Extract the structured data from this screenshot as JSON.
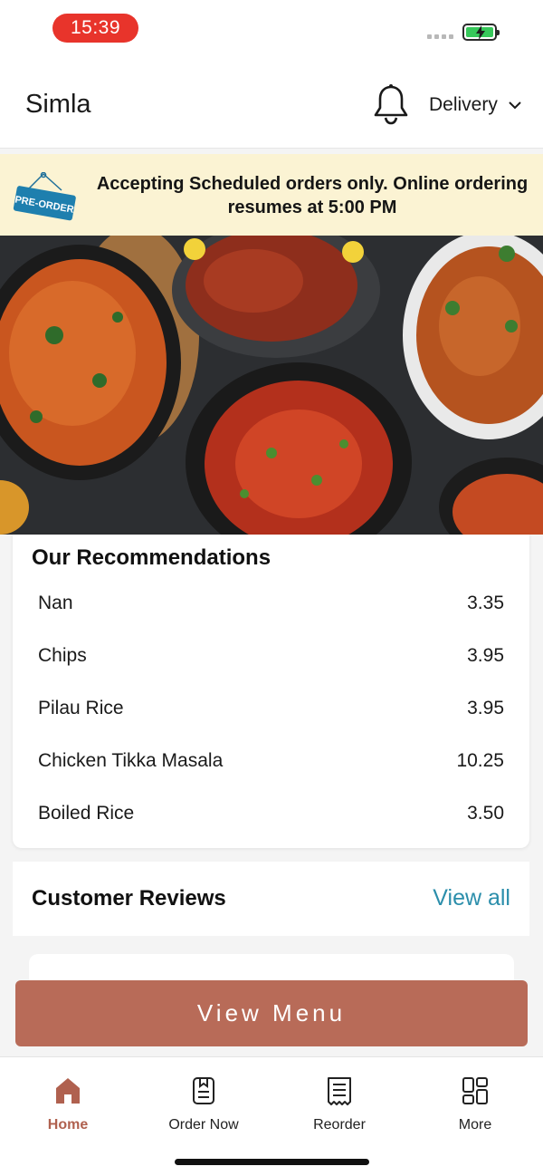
{
  "status_bar": {
    "time": "15:39"
  },
  "header": {
    "title": "Simla",
    "delivery_label": "Delivery"
  },
  "banner": {
    "badge": "PRE-ORDER",
    "message": "Accepting Scheduled orders only. Online ordering resumes at 5:00 PM"
  },
  "recommendations": {
    "title": "Our Recommendations",
    "items": [
      {
        "name": "Nan",
        "price": "3.35"
      },
      {
        "name": "Chips",
        "price": "3.95"
      },
      {
        "name": "Pilau Rice",
        "price": "3.95"
      },
      {
        "name": "Chicken Tikka Masala",
        "price": "10.25"
      },
      {
        "name": "Boiled Rice",
        "price": "3.50"
      }
    ]
  },
  "reviews": {
    "title": "Customer Reviews",
    "view_all": "View all"
  },
  "view_menu_button": "View Menu",
  "tab_bar": {
    "items": [
      {
        "label": "Home",
        "icon": "home-icon",
        "active": true
      },
      {
        "label": "Order Now",
        "icon": "order-icon",
        "active": false
      },
      {
        "label": "Reorder",
        "icon": "receipt-icon",
        "active": false
      },
      {
        "label": "More",
        "icon": "grid-icon",
        "active": false
      }
    ]
  },
  "colors": {
    "accent": "#b86b58",
    "banner_bg": "#fbf3d3",
    "link": "#2b8eab",
    "status_pill": "#e8342b"
  }
}
